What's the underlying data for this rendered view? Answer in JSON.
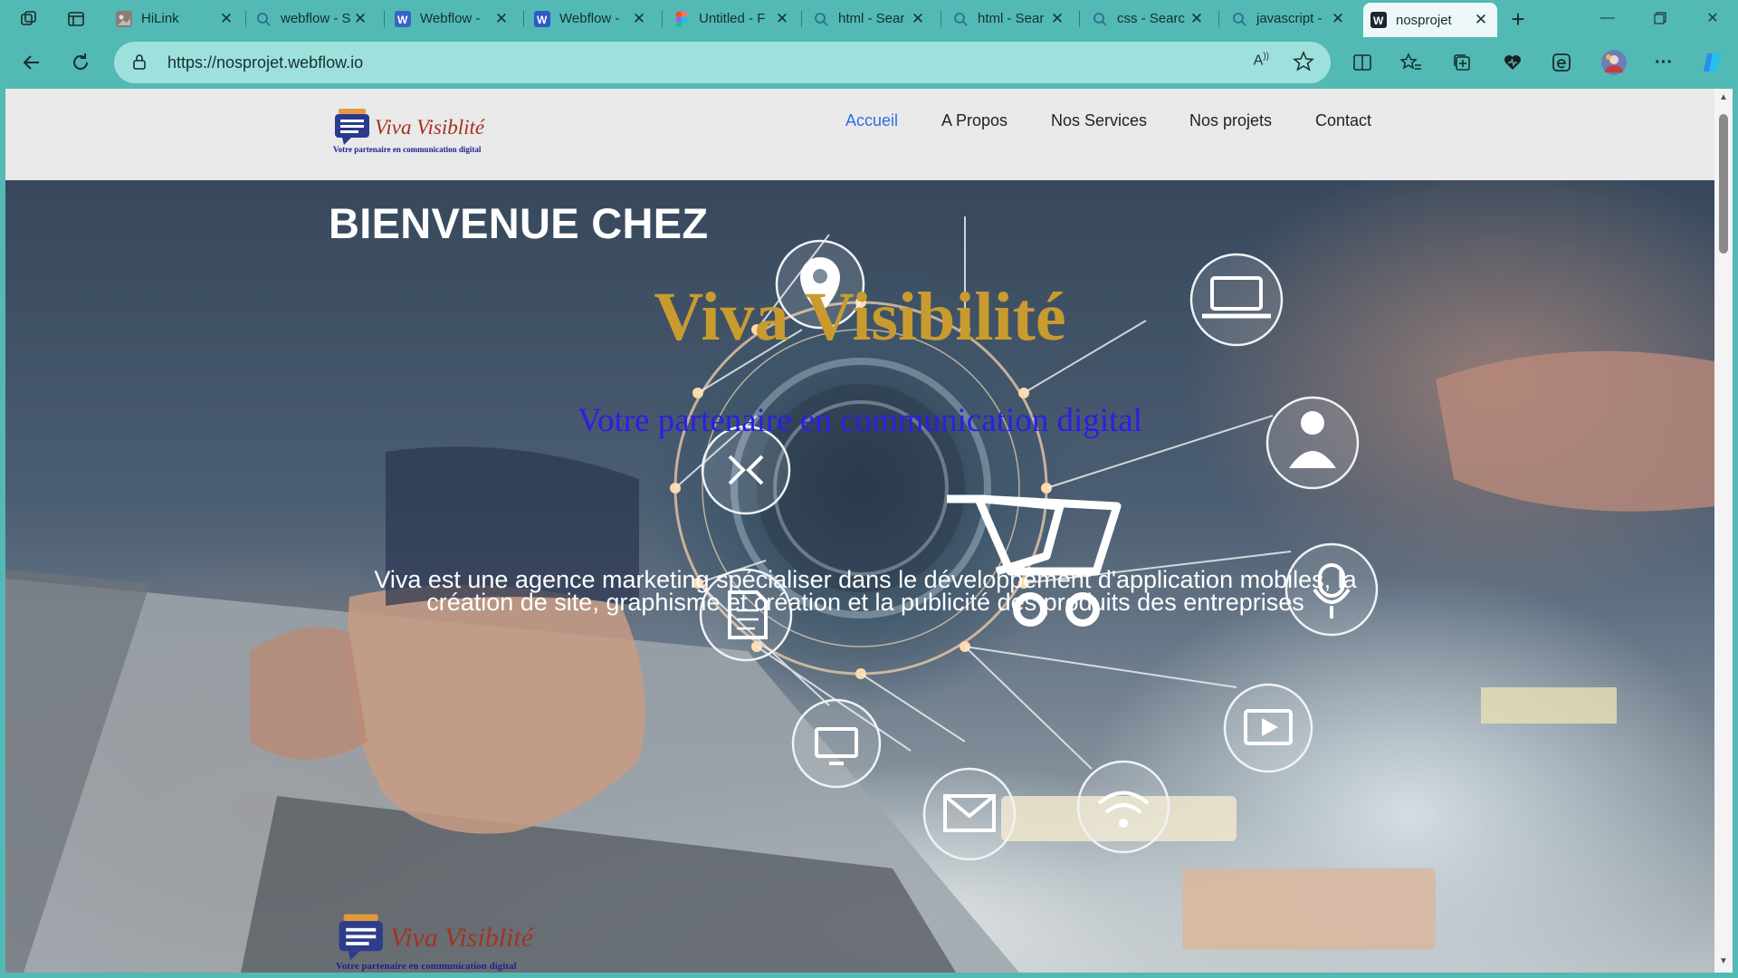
{
  "browser": {
    "tabs": [
      {
        "title": "HiLink",
        "favicon": "image-favicon"
      },
      {
        "title": "webflow - S",
        "favicon": "search-icon"
      },
      {
        "title": "Webflow - ",
        "favicon": "webflow-icon"
      },
      {
        "title": "Webflow - ",
        "favicon": "webflow-icon"
      },
      {
        "title": "Untitled - F",
        "favicon": "figma-icon"
      },
      {
        "title": "html - Sear",
        "favicon": "search-icon"
      },
      {
        "title": "html - Sear",
        "favicon": "search-icon"
      },
      {
        "title": "css - Searc",
        "favicon": "search-icon"
      },
      {
        "title": "javascript - ",
        "favicon": "search-icon"
      },
      {
        "title": "nosprojet",
        "favicon": "webflow-icon",
        "active": true
      }
    ],
    "url": "https://nosprojet.webflow.io",
    "accent_color": "#52b9b5"
  },
  "site": {
    "logo": {
      "name": "Viva Visiblité",
      "tagline": "Votre partenaire en communication digital"
    },
    "nav": {
      "items": [
        "Accueil",
        "A Propos",
        "Nos Services",
        "Nos projets",
        "Contact"
      ],
      "current": "Accueil"
    },
    "hero": {
      "welcome": "BIENVENUE CHEZ",
      "brand": "Viva Visibilité",
      "subtitle": "Votre partenaire en communication digital",
      "description": "Viva est une agence marketing spécialiser dans le développement d'application mobiles, la création de site, graphisme et création et la publicité des produits des entreprises"
    },
    "footer_logo": {
      "name": "Viva Visiblité",
      "tagline": "Votre partenaire en communication digital"
    },
    "colors": {
      "brand_gold": "#c99b2f",
      "subtitle_blue": "#2c1ee6",
      "nav_active": "#2e6fe0",
      "logo_red": "#a4321c"
    }
  }
}
